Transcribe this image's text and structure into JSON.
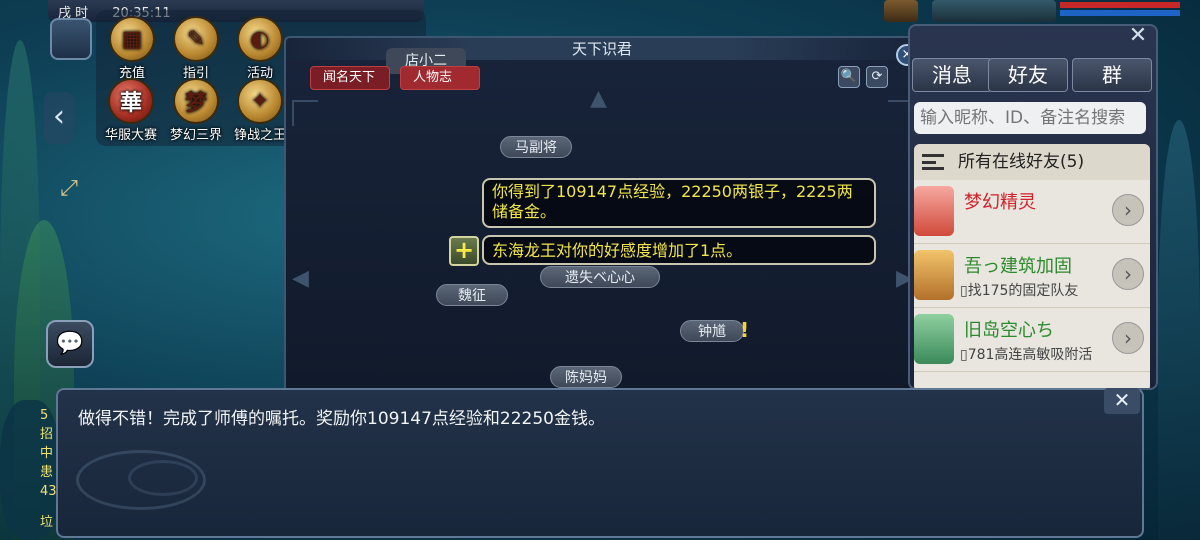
{
  "hud": {
    "time_prefix": "戌 时",
    "time_value": "20:35:11",
    "buttons": [
      {
        "label": "充值",
        "glyph": "▦"
      },
      {
        "label": "指引",
        "glyph": "✎"
      },
      {
        "label": "活动",
        "glyph": "◐"
      },
      {
        "label": "华服大赛",
        "glyph": "華"
      },
      {
        "label": "梦幻三界",
        "glyph": "梦"
      },
      {
        "label": "铮战之王",
        "glyph": "✦"
      }
    ],
    "side_arrow": "‹",
    "expand_glyph": "⤢",
    "chat_glyph": "💬"
  },
  "main_window": {
    "title": "天下识君",
    "tabs": [
      "闻名天下",
      "人物志"
    ],
    "search_glyph": "🔍",
    "refresh_glyph": "⟳",
    "close_glyph": "×",
    "caption": "店小二",
    "npcs": [
      "马副将",
      "遗失ベ心心",
      "魏征",
      "钟馗",
      "陈妈妈"
    ],
    "alert_glyph": "!"
  },
  "notices": {
    "exp_reward": "你得到了109147点经验，22250两银子，2225两储备金。",
    "favor": "东海龙王对你的好感度增加了1点。",
    "plus_glyph": "+"
  },
  "friends": {
    "tabs": [
      "消息",
      "好友",
      "群"
    ],
    "search_placeholder": "输入昵称、ID、备注名搜索",
    "list_header": "所有在线好友(5)",
    "rows": [
      {
        "name": "梦幻精灵",
        "signature": "",
        "name_color": "#d3202a"
      },
      {
        "name": "吾っ建筑加固",
        "signature": "▯找175的固定队友",
        "name_color": "#2c8a2c"
      },
      {
        "name": "旧岛空心ち",
        "signature": "▯781高连高敏吸附活",
        "name_color": "#2c8a2c"
      }
    ],
    "go_glyph": "›",
    "close_glyph": "✕"
  },
  "dialog": {
    "text": "做得不错！完成了师傅的嘱托。奖励你109147点经验和22250金钱。",
    "close_glyph": "✕"
  },
  "left_chat": [
    "5",
    "招",
    "中",
    "患",
    "43",
    "垃"
  ]
}
